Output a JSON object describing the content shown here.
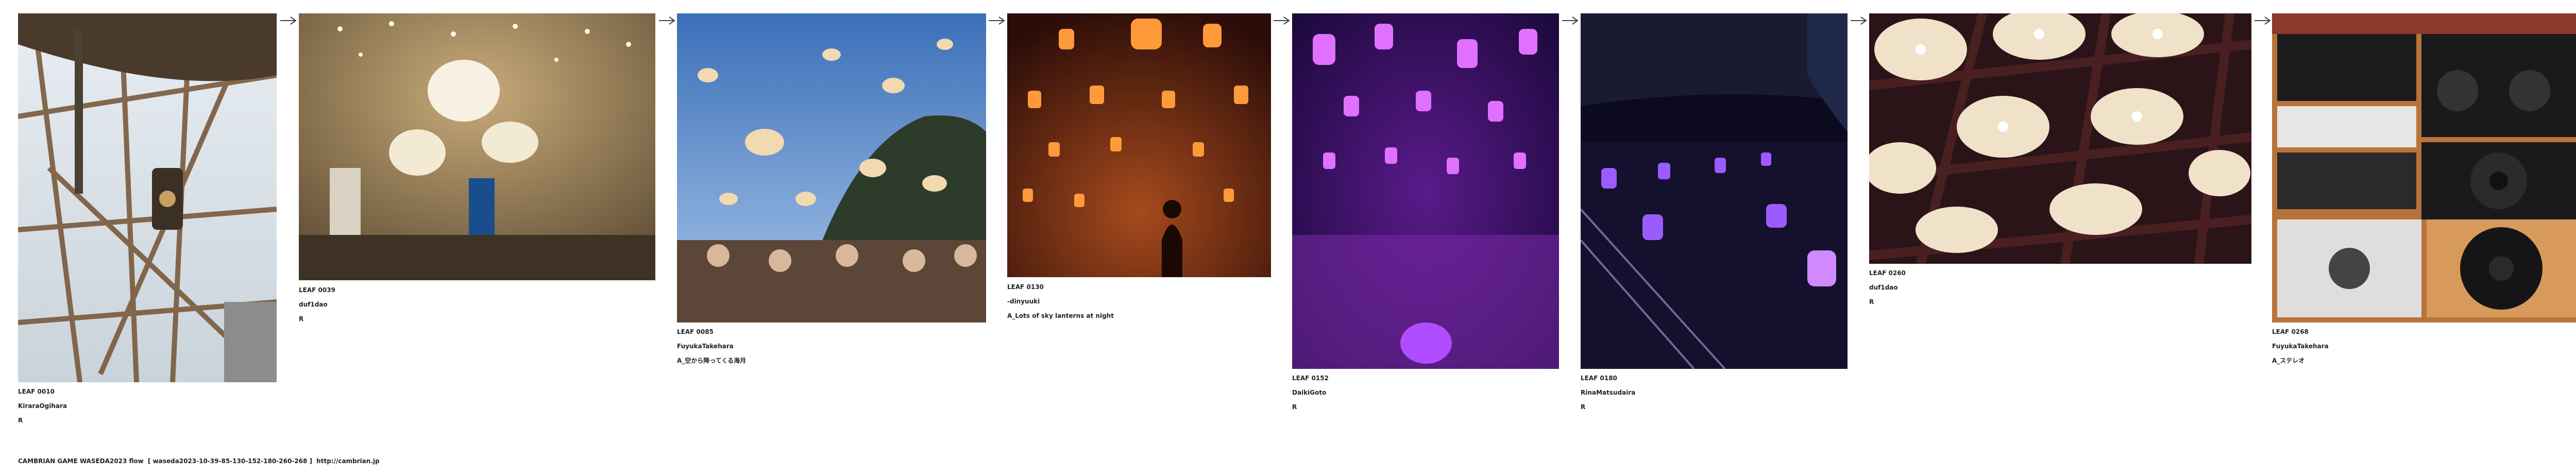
{
  "leaves": [
    {
      "id": "LEAF 0010",
      "author": "KiraraOgihara",
      "note": "R",
      "scene": "wooden-scaffold-lantern"
    },
    {
      "id": "LEAF 0039",
      "author": "duf1dao",
      "note": "R",
      "scene": "chandelier-hall"
    },
    {
      "id": "LEAF 0085",
      "author": "FuyukaTakehara",
      "note": "A_空から降ってくる海月",
      "scene": "jellyfish-sky-crowd"
    },
    {
      "id": "LEAF 0130",
      "author": "-dinyuuki",
      "note": "A_Lots of sky lanterns at night",
      "scene": "sky-lanterns-night"
    },
    {
      "id": "LEAF 0152",
      "author": "DaikiGoto",
      "note": "R",
      "scene": "purple-lantern-forest"
    },
    {
      "id": "LEAF 0180",
      "author": "RinaMatsudaira",
      "note": "R",
      "scene": "purple-lights-garden"
    },
    {
      "id": "LEAF 0260",
      "author": "duf1dao",
      "note": "R",
      "scene": "ceiling-lights"
    },
    {
      "id": "LEAF 0268",
      "author": "FuyukaTakehara",
      "note": "A_ステレオ",
      "scene": "stereo-speakers"
    }
  ],
  "footer": {
    "title": "CAMBRIAN GAME  WASEDA2023  flow",
    "flow": "[ waseda2023-10-39-85-130-152-180-260-268 ]",
    "url": "http://cambrian.jp"
  },
  "colors": {
    "text": "#222222",
    "background": "#ffffff",
    "arrow": "#444444"
  }
}
